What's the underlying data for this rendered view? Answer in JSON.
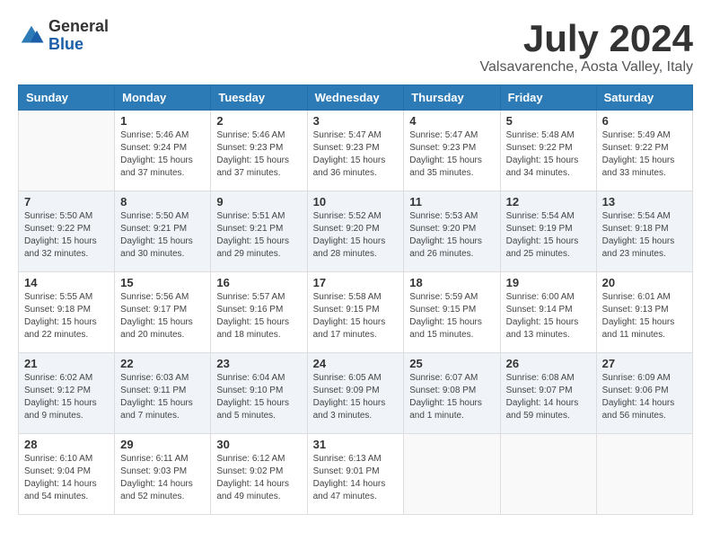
{
  "header": {
    "logo_general": "General",
    "logo_blue": "Blue",
    "month_title": "July 2024",
    "location": "Valsavarenche, Aosta Valley, Italy"
  },
  "weekdays": [
    "Sunday",
    "Monday",
    "Tuesday",
    "Wednesday",
    "Thursday",
    "Friday",
    "Saturday"
  ],
  "weeks": [
    [
      {
        "day": "",
        "info": ""
      },
      {
        "day": "1",
        "info": "Sunrise: 5:46 AM\nSunset: 9:24 PM\nDaylight: 15 hours\nand 37 minutes."
      },
      {
        "day": "2",
        "info": "Sunrise: 5:46 AM\nSunset: 9:23 PM\nDaylight: 15 hours\nand 37 minutes."
      },
      {
        "day": "3",
        "info": "Sunrise: 5:47 AM\nSunset: 9:23 PM\nDaylight: 15 hours\nand 36 minutes."
      },
      {
        "day": "4",
        "info": "Sunrise: 5:47 AM\nSunset: 9:23 PM\nDaylight: 15 hours\nand 35 minutes."
      },
      {
        "day": "5",
        "info": "Sunrise: 5:48 AM\nSunset: 9:22 PM\nDaylight: 15 hours\nand 34 minutes."
      },
      {
        "day": "6",
        "info": "Sunrise: 5:49 AM\nSunset: 9:22 PM\nDaylight: 15 hours\nand 33 minutes."
      }
    ],
    [
      {
        "day": "7",
        "info": "Sunrise: 5:50 AM\nSunset: 9:22 PM\nDaylight: 15 hours\nand 32 minutes."
      },
      {
        "day": "8",
        "info": "Sunrise: 5:50 AM\nSunset: 9:21 PM\nDaylight: 15 hours\nand 30 minutes."
      },
      {
        "day": "9",
        "info": "Sunrise: 5:51 AM\nSunset: 9:21 PM\nDaylight: 15 hours\nand 29 minutes."
      },
      {
        "day": "10",
        "info": "Sunrise: 5:52 AM\nSunset: 9:20 PM\nDaylight: 15 hours\nand 28 minutes."
      },
      {
        "day": "11",
        "info": "Sunrise: 5:53 AM\nSunset: 9:20 PM\nDaylight: 15 hours\nand 26 minutes."
      },
      {
        "day": "12",
        "info": "Sunrise: 5:54 AM\nSunset: 9:19 PM\nDaylight: 15 hours\nand 25 minutes."
      },
      {
        "day": "13",
        "info": "Sunrise: 5:54 AM\nSunset: 9:18 PM\nDaylight: 15 hours\nand 23 minutes."
      }
    ],
    [
      {
        "day": "14",
        "info": "Sunrise: 5:55 AM\nSunset: 9:18 PM\nDaylight: 15 hours\nand 22 minutes."
      },
      {
        "day": "15",
        "info": "Sunrise: 5:56 AM\nSunset: 9:17 PM\nDaylight: 15 hours\nand 20 minutes."
      },
      {
        "day": "16",
        "info": "Sunrise: 5:57 AM\nSunset: 9:16 PM\nDaylight: 15 hours\nand 18 minutes."
      },
      {
        "day": "17",
        "info": "Sunrise: 5:58 AM\nSunset: 9:15 PM\nDaylight: 15 hours\nand 17 minutes."
      },
      {
        "day": "18",
        "info": "Sunrise: 5:59 AM\nSunset: 9:15 PM\nDaylight: 15 hours\nand 15 minutes."
      },
      {
        "day": "19",
        "info": "Sunrise: 6:00 AM\nSunset: 9:14 PM\nDaylight: 15 hours\nand 13 minutes."
      },
      {
        "day": "20",
        "info": "Sunrise: 6:01 AM\nSunset: 9:13 PM\nDaylight: 15 hours\nand 11 minutes."
      }
    ],
    [
      {
        "day": "21",
        "info": "Sunrise: 6:02 AM\nSunset: 9:12 PM\nDaylight: 15 hours\nand 9 minutes."
      },
      {
        "day": "22",
        "info": "Sunrise: 6:03 AM\nSunset: 9:11 PM\nDaylight: 15 hours\nand 7 minutes."
      },
      {
        "day": "23",
        "info": "Sunrise: 6:04 AM\nSunset: 9:10 PM\nDaylight: 15 hours\nand 5 minutes."
      },
      {
        "day": "24",
        "info": "Sunrise: 6:05 AM\nSunset: 9:09 PM\nDaylight: 15 hours\nand 3 minutes."
      },
      {
        "day": "25",
        "info": "Sunrise: 6:07 AM\nSunset: 9:08 PM\nDaylight: 15 hours\nand 1 minute."
      },
      {
        "day": "26",
        "info": "Sunrise: 6:08 AM\nSunset: 9:07 PM\nDaylight: 14 hours\nand 59 minutes."
      },
      {
        "day": "27",
        "info": "Sunrise: 6:09 AM\nSunset: 9:06 PM\nDaylight: 14 hours\nand 56 minutes."
      }
    ],
    [
      {
        "day": "28",
        "info": "Sunrise: 6:10 AM\nSunset: 9:04 PM\nDaylight: 14 hours\nand 54 minutes."
      },
      {
        "day": "29",
        "info": "Sunrise: 6:11 AM\nSunset: 9:03 PM\nDaylight: 14 hours\nand 52 minutes."
      },
      {
        "day": "30",
        "info": "Sunrise: 6:12 AM\nSunset: 9:02 PM\nDaylight: 14 hours\nand 49 minutes."
      },
      {
        "day": "31",
        "info": "Sunrise: 6:13 AM\nSunset: 9:01 PM\nDaylight: 14 hours\nand 47 minutes."
      },
      {
        "day": "",
        "info": ""
      },
      {
        "day": "",
        "info": ""
      },
      {
        "day": "",
        "info": ""
      }
    ]
  ]
}
